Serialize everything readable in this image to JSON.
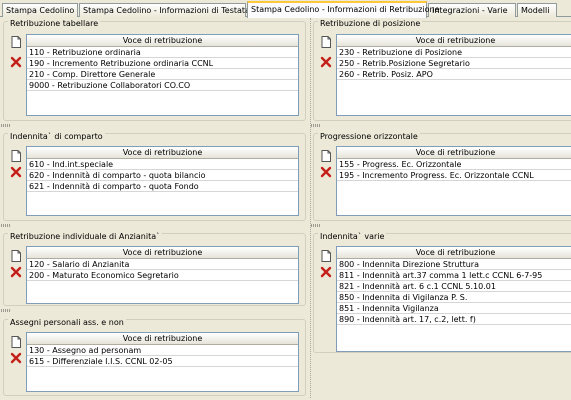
{
  "tabs": [
    {
      "label": "Stampa Cedolino"
    },
    {
      "label": "Stampa Cedolino - Informazioni di Testata"
    },
    {
      "label": "Stampa Cedolino - Informazioni di Retribuzione"
    },
    {
      "label": "Integrazioni - Varie"
    },
    {
      "label": "Modelli"
    }
  ],
  "column_header": "Voce di retribuzione",
  "panels": {
    "tabellare": {
      "title": "Retribuzione tabellare",
      "rows": [
        "110  -  Retribuzione ordinaria",
        "190  -  Incremento Retribuzione ordinaria CCNL",
        "210  -  Comp. Direttore Generale",
        "9000  -  Retribuzione Collaboratori CO.CO"
      ]
    },
    "posizione": {
      "title": "Retribuzione di posizione",
      "rows": [
        "230  -  Retribuzione di Posizione",
        "250  -  Retrib.Posizione Segretario",
        "260  -  Retrib. Posiz. APO"
      ]
    },
    "comparto": {
      "title": "Indennita` di comparto",
      "rows": [
        "610  -  Ind.int.speciale",
        "620  -  Indennità di comparto - quota bilancio",
        "621  -  Indennità di comparto - quota Fondo"
      ]
    },
    "progressione": {
      "title": "Progressione orizzontale",
      "rows": [
        "155  -  Progress. Ec. Orizzontale",
        "195  -  Incremento Progress. Ec. Orizzontale CCNL"
      ]
    },
    "anzianita": {
      "title": "Retribuzione individuale di Anzianita`",
      "rows": [
        "120  -  Salario di Anzianita",
        "200  -  Maturato Economico Segretario"
      ]
    },
    "varie": {
      "title": "Indennita` varie",
      "rows": [
        "800  -  Indennita Direzione Struttura",
        "811  -  Indennità art.37 comma 1 lett.c CCNL 6-7-95",
        "821  -  Indennità art. 6 c.1 CCNL 5.10.01",
        "850  -  Indennita di Vigilanza P. S.",
        "851  -  Indennita Vigilanza",
        "890  -  Indennità art. 17, c.2, lett. f)"
      ]
    },
    "assegni": {
      "title": "Assegni personali ass. e non",
      "rows": [
        "130  -  Assegno ad personam",
        "615  -  Differenziale I.I.S. CCNL 02-05"
      ]
    }
  }
}
